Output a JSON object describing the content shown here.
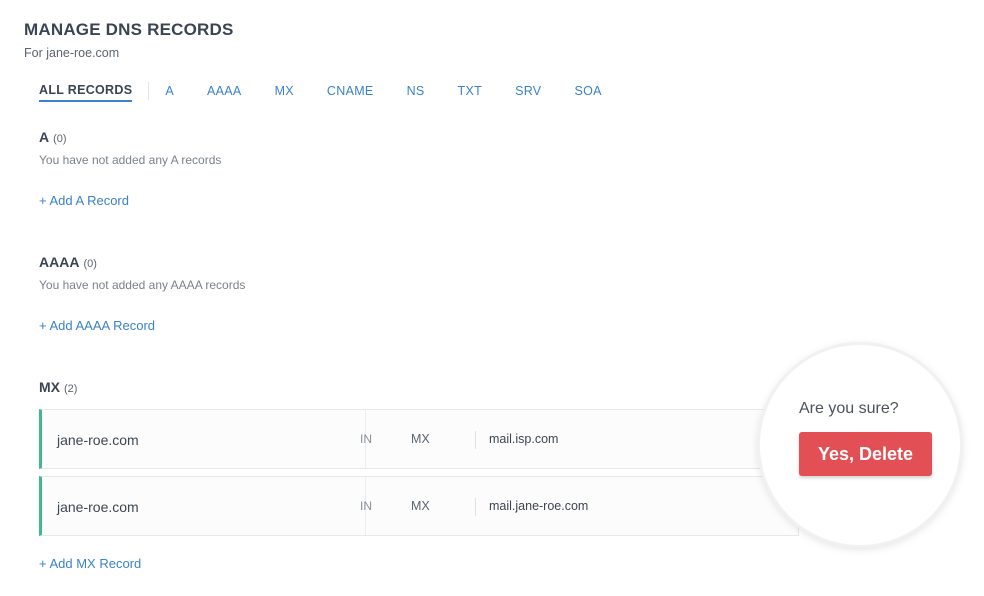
{
  "header": {
    "title": "MANAGE DNS RECORDS",
    "subtitle": "For jane-roe.com"
  },
  "tabs": [
    {
      "label": "ALL RECORDS",
      "active": true
    },
    {
      "label": "A"
    },
    {
      "label": "AAAA"
    },
    {
      "label": "MX"
    },
    {
      "label": "CNAME"
    },
    {
      "label": "NS"
    },
    {
      "label": "TXT"
    },
    {
      "label": "SRV"
    },
    {
      "label": "SOA"
    }
  ],
  "sections": {
    "a": {
      "title": "A",
      "count": "(0)",
      "empty": "You have not added any A records",
      "add_label": "+ Add A Record"
    },
    "aaaa": {
      "title": "AAAA",
      "count": "(0)",
      "empty": "You have not added any AAAA records",
      "add_label": "+ Add AAAA Record"
    },
    "mx": {
      "title": "MX",
      "count": "(2)",
      "add_label": "+ Add MX Record",
      "records": [
        {
          "host": "jane-roe.com",
          "class": "IN",
          "type": "MX",
          "value": "mail.isp.com"
        },
        {
          "host": "jane-roe.com",
          "class": "IN",
          "type": "MX",
          "value": "mail.jane-roe.com"
        }
      ]
    }
  },
  "confirm": {
    "question": "Are you sure?",
    "button_label": "Yes, Delete"
  },
  "colors": {
    "accent": "#3a82c9",
    "record_border": "#3dba8a",
    "danger": "#e24f55"
  },
  "icons": {
    "row_menu": "chevron-down-icon"
  }
}
